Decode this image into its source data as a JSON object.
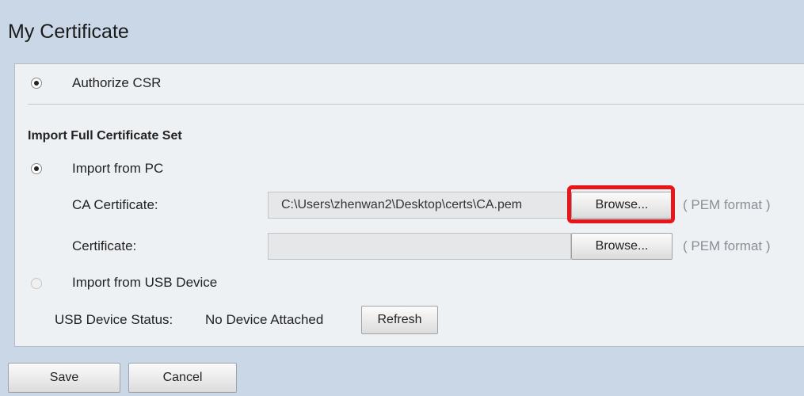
{
  "page": {
    "title": "My Certificate"
  },
  "options": {
    "authorize_csr_label": "Authorize CSR",
    "import_section_heading": "Import Full Certificate Set",
    "import_from_pc_label": "Import from PC",
    "import_from_usb_label": "Import from USB Device"
  },
  "fields": {
    "ca_certificate_label": "CA Certificate:",
    "ca_certificate_value": "C:\\Users\\zhenwan2\\Desktop\\certs\\CA.pem",
    "certificate_label": "Certificate:",
    "certificate_value": "",
    "browse_label": "Browse...",
    "format_hint": "( PEM format )"
  },
  "usb": {
    "status_label": "USB Device Status:",
    "status_value": "No Device Attached",
    "refresh_label": "Refresh"
  },
  "actions": {
    "save_label": "Save",
    "cancel_label": "Cancel"
  },
  "colors": {
    "highlight": "#e8161b",
    "background": "#c9d7e6",
    "panel": "#eef1f4"
  }
}
